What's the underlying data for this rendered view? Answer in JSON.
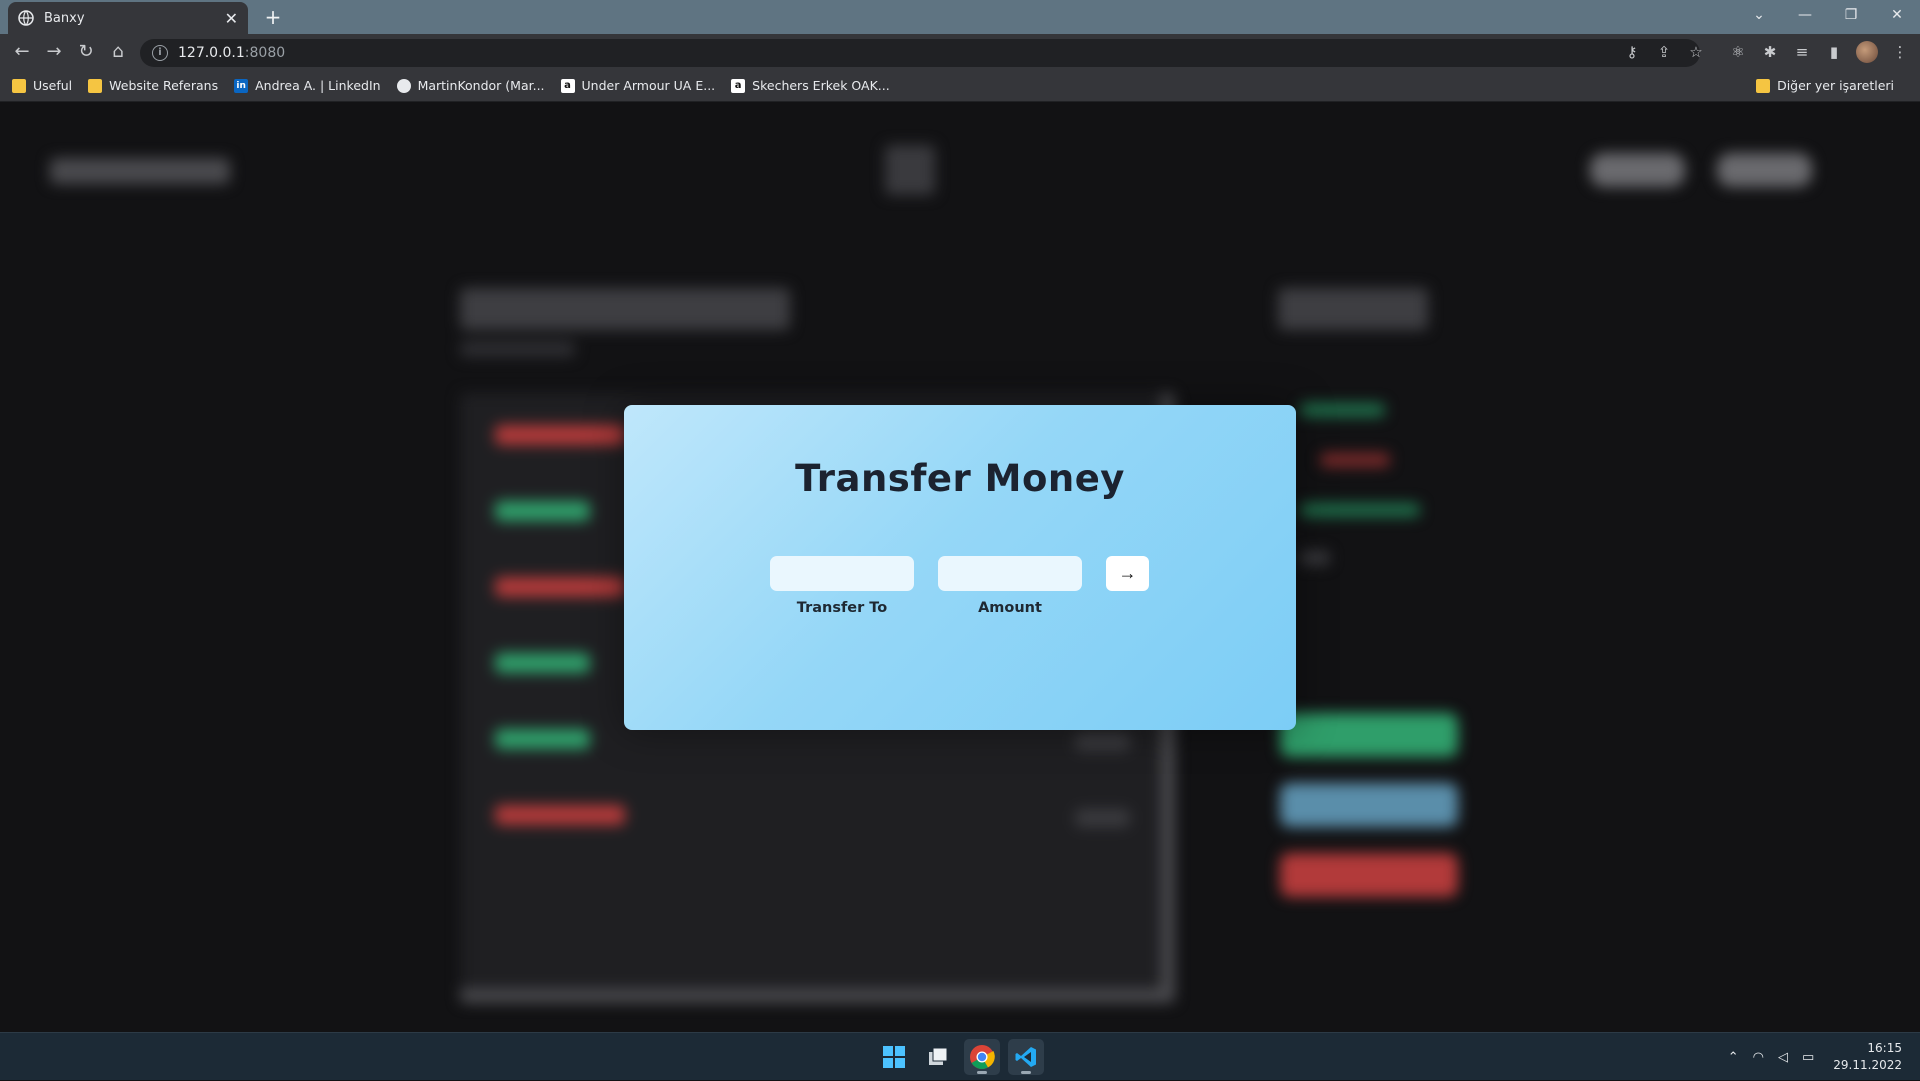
{
  "browser": {
    "tab_title": "Banxy",
    "url_host": "127.0.0.1",
    "url_port": ":8080",
    "bookmarks": [
      "Useful",
      "Website Referans",
      "Andrea A. | LinkedIn",
      "MartinKondor (Mar...",
      "Under Armour UA E...",
      "Skechers Erkek OAK..."
    ],
    "other_bookmarks": "Diğer yer işaretleri"
  },
  "modal": {
    "title": "Transfer Money",
    "transfer_to_label": "Transfer To",
    "amount_label": "Amount",
    "transfer_to_value": "",
    "amount_value": "",
    "submit_label": "→"
  },
  "taskbar": {
    "time": "16:15",
    "date": "29.11.2022"
  },
  "colors": {
    "modal_gradient_start": "#bfe7fb",
    "modal_gradient_end": "#7ccdf6",
    "page_background": "#121214",
    "income_green": "#2f9e6a",
    "expense_red": "#b23a3a"
  }
}
